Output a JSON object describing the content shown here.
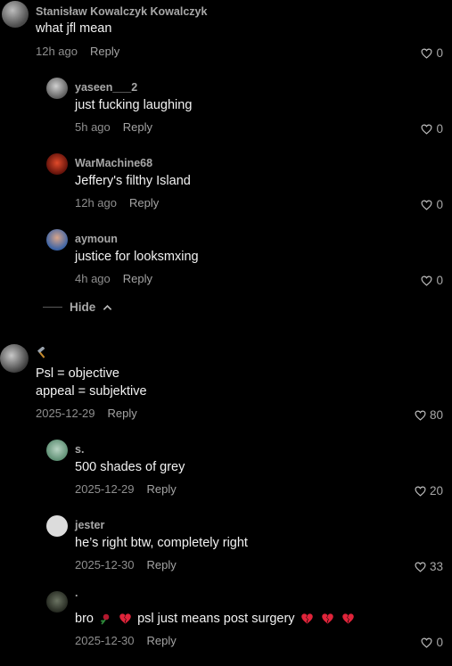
{
  "comments": [
    {
      "username": "Stanisław Kowalczyk Kowalczyk",
      "text": "what jfl mean",
      "time": "12h ago",
      "reply": "Reply",
      "likes": "0",
      "avatar_color": "#6b6b6b"
    },
    {
      "username": "yaseen___2",
      "text": "just fucking laughing",
      "time": "5h ago",
      "reply": "Reply",
      "likes": "0",
      "avatar_color": "#7a7a7a"
    },
    {
      "username": "WarMachine68",
      "text": "Jeffery's filthy Island",
      "time": "12h ago",
      "reply": "Reply",
      "likes": "0",
      "avatar_color": "#b03020"
    },
    {
      "username": "aymoun",
      "text": "justice for looksmxing",
      "time": "4h ago",
      "reply": "Reply",
      "likes": "0",
      "avatar_color": "#4a7ab8"
    },
    {
      "username": "",
      "username_emoji": "hammer-icon",
      "text_line1": "Psl = objective",
      "text_line2": "appeal = subjektive",
      "time": "2025-12-29",
      "reply": "Reply",
      "likes": "80",
      "avatar_color": "#5f5f5f"
    },
    {
      "username": "s.",
      "text": "500 shades of grey",
      "time": "2025-12-29",
      "reply": "Reply",
      "likes": "20",
      "avatar_color": "#7fae9a"
    },
    {
      "username": "jester",
      "text": "he’s right btw, completely right",
      "time": "2025-12-30",
      "reply": "Reply",
      "likes": "33",
      "avatar_color": "#e6e6e6"
    },
    {
      "username": ".",
      "text_a": "bro",
      "text_b": "psl just means post surgery",
      "time": "2025-12-30",
      "reply": "Reply",
      "likes": "0",
      "avatar_color": "#3e4438"
    }
  ],
  "hide_label": "Hide",
  "colors": {
    "background": "#000000",
    "heart_broken": "#e0243a"
  }
}
